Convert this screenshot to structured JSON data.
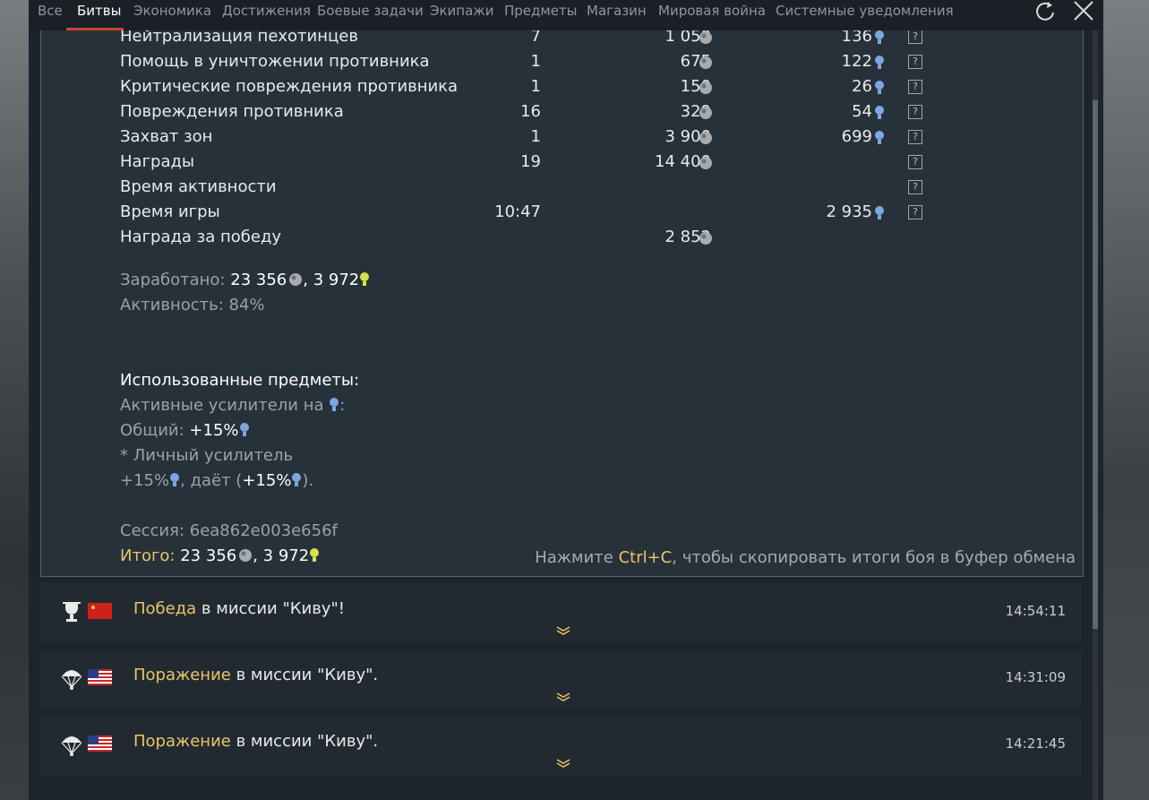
{
  "tabs": [
    "Все",
    "Битвы",
    "Экономика",
    "Достижения",
    "Боевые задачи",
    "Экипажи",
    "Предметы",
    "Магазин",
    "Мировая война",
    "Системные уведомления"
  ],
  "active_tab": "Битвы",
  "rows": [
    {
      "label": "Нейтрализация пехотинцев",
      "count": "7",
      "silver": "1 050",
      "rp": "136",
      "help": "?"
    },
    {
      "label": "Помощь в уничтожении противника",
      "count": "1",
      "silver": "675",
      "rp": "122",
      "help": "?"
    },
    {
      "label": "Критические повреждения противника",
      "count": "1",
      "silver": "150",
      "rp": "26",
      "help": "?"
    },
    {
      "label": "Повреждения противника",
      "count": "16",
      "silver": "329",
      "rp": "54",
      "help": "?"
    },
    {
      "label": "Захват зон",
      "count": "1",
      "silver": "3 900",
      "rp": "699",
      "help": "?"
    },
    {
      "label": "Награды",
      "count": "19",
      "silver": "14 400",
      "rp": "",
      "help": "?"
    },
    {
      "label": "Время активности",
      "count": "",
      "silver": "",
      "rp": "",
      "help": "?"
    },
    {
      "label": "Время игры",
      "count": "10:47",
      "silver": "",
      "rp": "2 935",
      "help": "?"
    },
    {
      "label": "Награда за победу",
      "count": "",
      "silver": "2 852",
      "rp": "",
      "help": ""
    }
  ],
  "earned": {
    "label": "Заработано:",
    "silver": "23 356",
    "sep": ", ",
    "rp": "3 972"
  },
  "activity": "Активность: 84%",
  "items": {
    "heading": "Использованные предметы:",
    "boosters_label": "Активные усилители на",
    "boosters_colon": ":",
    "general_label": "Общий:",
    "general_value": "+15%",
    "personal_label": "* Личный усилитель",
    "personal_value": "+15%",
    "gives_text": ", даёт (",
    "gives_value": "+15%",
    "gives_close": ")."
  },
  "session": "Сессия: 6ea862e003e656f",
  "total": {
    "label": "Итого:",
    "silver": "23 356",
    "sep": ", ",
    "rp": "3 972"
  },
  "copy_hint": {
    "before": "Нажмите ",
    "key": "Ctrl+C",
    "after": ", чтобы скопировать итоги боя в буфер обмена"
  },
  "battles": [
    {
      "result": "Победа",
      "text": " в миссии \"Киву\"!",
      "time": "14:54:11",
      "icon": "trophy-icon",
      "flag": "ussr-flag"
    },
    {
      "result": "Поражение",
      "text": " в миссии \"Киву\".",
      "time": "14:31:09",
      "icon": "parachute-icon",
      "flag": "usa-flag"
    },
    {
      "result": "Поражение",
      "text": " в миссии \"Киву\".",
      "time": "14:21:45",
      "icon": "parachute-icon",
      "flag": "usa-flag"
    }
  ],
  "colors": {
    "gold": "#e8c56a",
    "rp_blue": "#7ea6e0",
    "accent": "#c8462a"
  }
}
